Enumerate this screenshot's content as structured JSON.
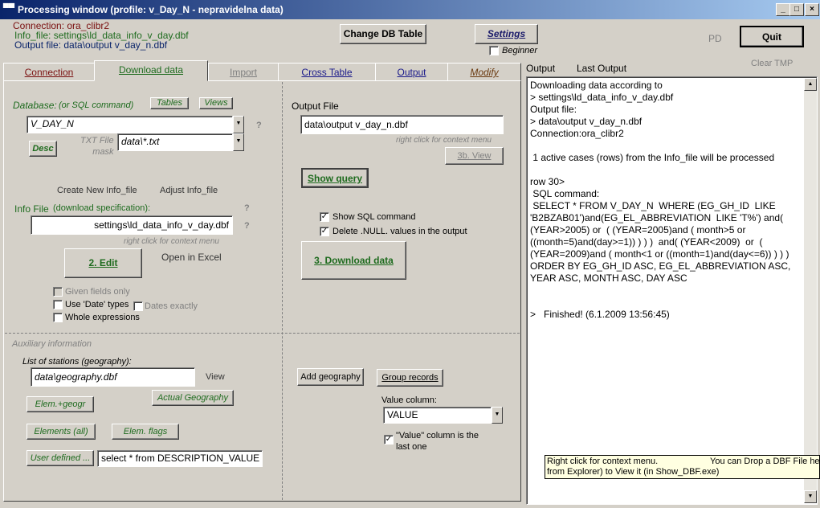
{
  "window": {
    "title": "Processing window (profile: v_Day_N  - nepravidelna data)",
    "minimize": "_",
    "maximize": "□",
    "close": "×"
  },
  "header": {
    "connection": "Connection:  ora_clibr2",
    "info_file": "Info_file: settings\\ld_data_info_v_day.dbf",
    "output_file": "Output file:  data\\output v_day_n.dbf",
    "change_db_table": "Change DB Table",
    "settings": "Settings",
    "beginner": "Beginner",
    "pd": "PD",
    "quit": "Quit",
    "clear_tmp": "Clear TMP"
  },
  "tabs": [
    {
      "label": "Connection"
    },
    {
      "label": "Download data"
    },
    {
      "label": "Import"
    },
    {
      "label": "Cross Table"
    },
    {
      "label": "Output"
    },
    {
      "label": "Modify"
    }
  ],
  "download": {
    "database_label": "Database:",
    "database_hint": "(or SQL command)",
    "tables": "Tables",
    "views": "Views",
    "database_value": "V_DAY_N",
    "question": "?",
    "desc": "Desc",
    "txt_file_label": "TXT File\nmask",
    "txt_mask_value": "data\\*.txt",
    "create_info": "Create New Info_file",
    "adjust_info": "Adjust Info_file",
    "info_file_label": "Info File",
    "info_file_hint": "(download specification):",
    "info_file_value": "settings\\ld_data_info_v_day.dbf",
    "context_hint": "right click for context menu",
    "edit": "2. Edit",
    "open_excel": "Open in Excel",
    "given_fields": "Given fields only",
    "use_date": "Use 'Date' types",
    "dates_exactly": "Dates exactly",
    "whole_expr": "Whole expressions",
    "output_file_label": "Output File",
    "output_file_value": "data\\output v_day_n.dbf",
    "output_hint": "right click for context menu",
    "view_3b": "3b. View",
    "show_query": "Show query",
    "show_sql": "Show SQL command",
    "delete_null": "Delete .NULL. values in the output",
    "download_btn": "3. Download data"
  },
  "aux": {
    "title": "Auxiliary information",
    "stations_label": "List of stations (geography):",
    "stations_value": "data\\geography.dbf",
    "view": "View",
    "actual_geo": "Actual Geography",
    "elem_geogr": "Elem.+geogr",
    "elements_all": "Elements (all)",
    "elem_flags": "Elem. flags",
    "user_defined": "User defined ...",
    "user_sql": "select * from DESCRIPTION_VALUE",
    "add_geo": "Add geography",
    "group_records": "Group records",
    "value_col_label": "Value column:",
    "value_col": "VALUE",
    "value_last": "\"Value\" column is the\nlast one"
  },
  "right": {
    "output_tab": "Output",
    "last_output_tab": "Last Output",
    "text": "Downloading data according to\n> settings\\ld_data_info_v_day.dbf\nOutput file:\n> data\\output v_day_n.dbf\nConnection:ora_clibr2\n\n 1 active cases (rows) from the Info_file will be processed\n\nrow 30>\n SQL command:\n SELECT * FROM V_DAY_N  WHERE (EG_GH_ID  LIKE\n'B2BZAB01')and(EG_EL_ABBREVIATION  LIKE 'T%') and(\n(YEAR>2005) or  ( (YEAR=2005)and ( month>5 or\n((month=5)and(day>=1)) ) ) )  and( (YEAR<2009)  or  (\n(YEAR=2009)and ( month<1 or ((month=1)and(day<=6)) ) ) )\nORDER BY EG_GH_ID ASC, EG_EL_ABBREVIATION ASC,\nYEAR ASC, MONTH ASC, DAY ASC\n\n\n>   Finished! (6.1.2009 13:56:45)",
    "tooltip_left": "Right click for context menu.",
    "tooltip_right": "You can Drop a DBF File here",
    "tooltip_line2": "from Explorer) to View it (in Show_DBF.exe)"
  }
}
